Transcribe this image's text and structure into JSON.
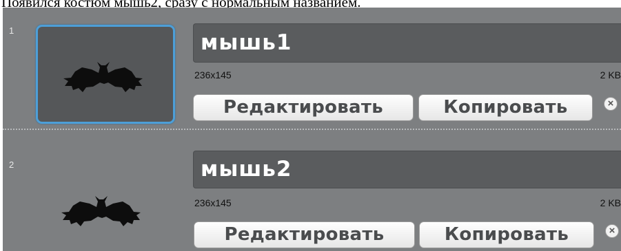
{
  "caption": "Появился костюм мышь2, сразу с нормальным названием.",
  "costumes": [
    {
      "index": "1",
      "name": "мышь1",
      "dimensions": "236x145",
      "file_size": "2 KB",
      "selected": true,
      "thumbnail_icon": "bat-icon",
      "edit_label": "Редактировать",
      "copy_label": "Копировать",
      "delete_icon": "close-icon"
    },
    {
      "index": "2",
      "name": "мышь2",
      "dimensions": "236x145",
      "file_size": "2 KB",
      "selected": false,
      "thumbnail_icon": "bat-icon",
      "edit_label": "Редактировать",
      "copy_label": "Копировать",
      "delete_icon": "close-icon"
    }
  ],
  "colors": {
    "panel_background": "#7d7f81",
    "selection_border": "#4d9fd8",
    "name_field_background": "#5a5c5e"
  }
}
